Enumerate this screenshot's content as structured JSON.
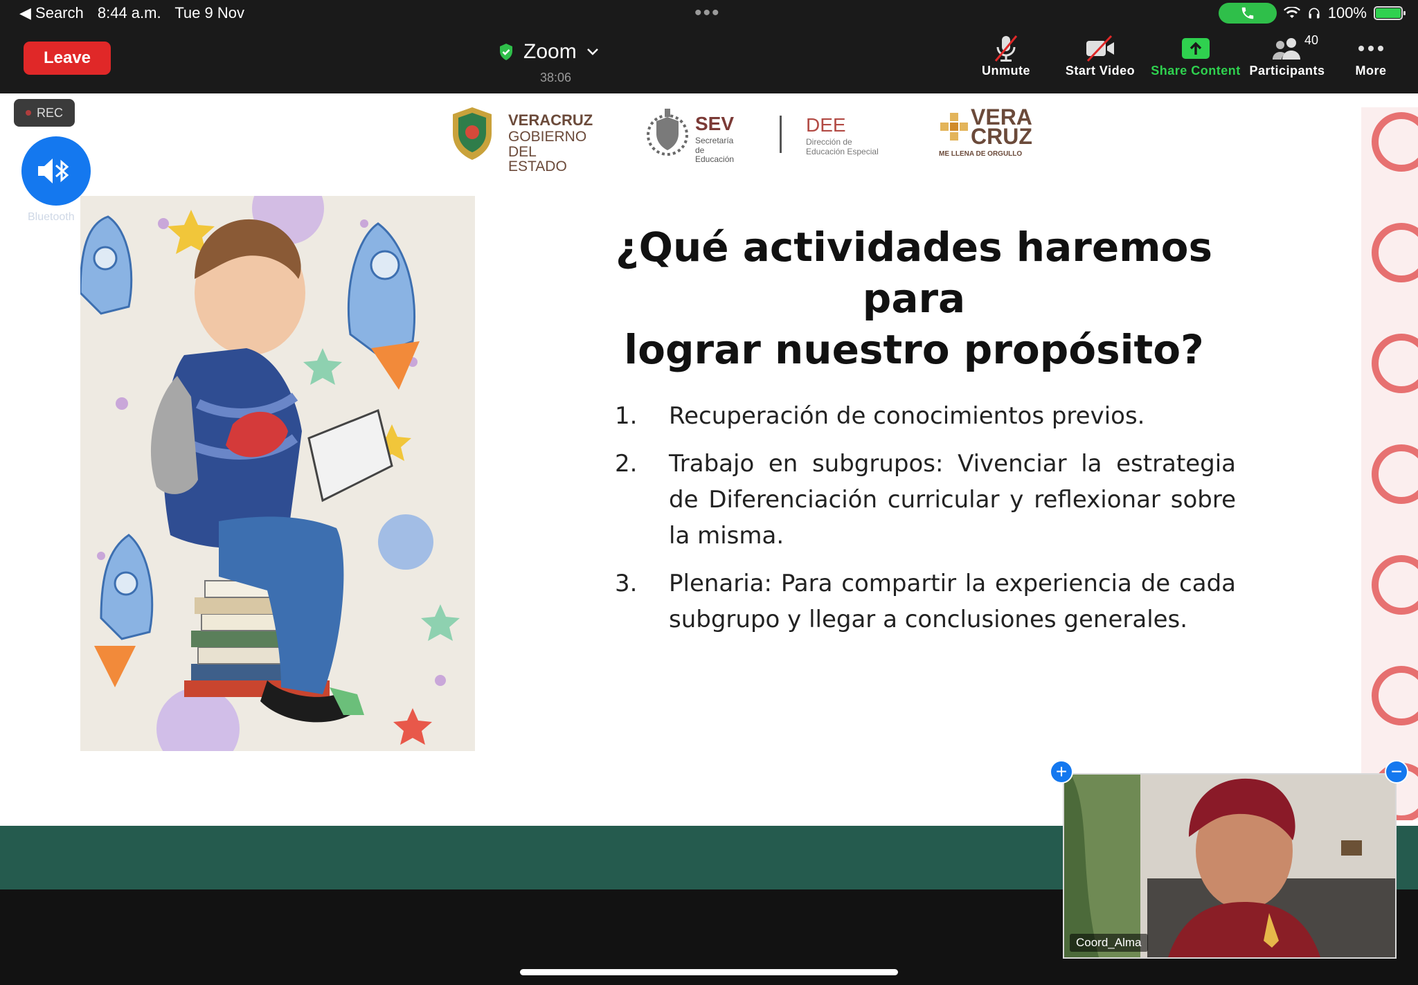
{
  "status_bar": {
    "back_label": "◀ Search",
    "time": "8:44 a.m.",
    "date": "Tue 9 Nov",
    "dots": "•••",
    "battery": "100%",
    "battery_level": 1.0
  },
  "toolbar": {
    "leave_label": "Leave",
    "meeting_title": "Zoom",
    "timer": "38:06",
    "unmute_label": "Unmute",
    "start_video_label": "Start Video",
    "share_label": "Share Content",
    "participants_label": "Participants",
    "participants_count": "40",
    "more_label": "More"
  },
  "overlay": {
    "rec_label": "REC",
    "bluetooth_label": "Bluetooth"
  },
  "slide": {
    "logos": {
      "veracruz_gob": [
        "VERACRUZ",
        "GOBIERNO",
        "DEL ESTADO"
      ],
      "sev": [
        "SEV",
        "Secretaría",
        "de Educación"
      ],
      "dee": [
        "DEE",
        "Dirección de",
        "Educación Especial"
      ],
      "vera_cruz": [
        "VERA",
        "CRUZ",
        "ME LLENA DE ORGULLO"
      ]
    },
    "title_line1": "¿Qué actividades haremos para",
    "title_line2": "lograr nuestro propósito?",
    "items": [
      {
        "num": "1.",
        "text": "Recuperación de conocimientos previos."
      },
      {
        "num": "2.",
        "text": "Trabajo en subgrupos: Vivenciar la estrategia de Diferenciación curricular y reflexionar sobre la misma."
      },
      {
        "num": "3.",
        "text": "Plenaria: Para compartir la experiencia de cada subgrupo y llegar a conclusiones generales."
      }
    ]
  },
  "pip": {
    "participant_name": "Coord_Alma",
    "plus": "+",
    "minus": "−"
  },
  "colors": {
    "leave_red": "#e02828",
    "zoom_blue": "#1478ef",
    "share_green": "#2fd14f",
    "band_green": "#255b4e"
  }
}
